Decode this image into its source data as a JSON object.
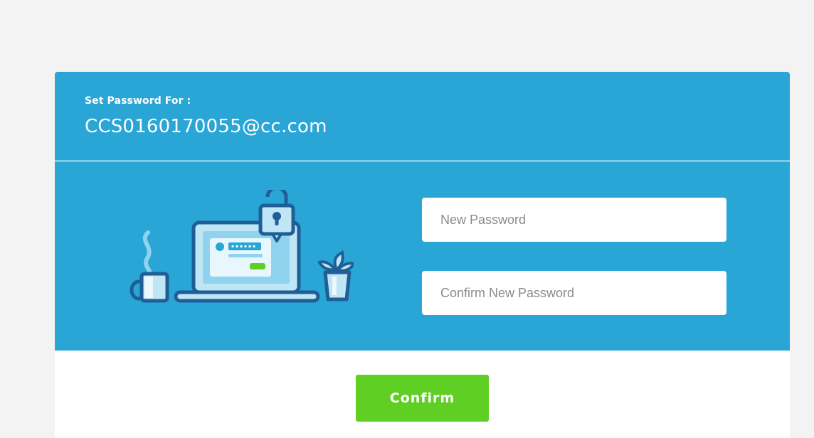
{
  "header": {
    "label": "Set Password For :",
    "email": "CCS0160170055@cc.com"
  },
  "form": {
    "new_password": {
      "value": "",
      "placeholder": "New Password"
    },
    "confirm_password": {
      "value": "",
      "placeholder": "Confirm New Password"
    },
    "confirm_label": "Confirm"
  },
  "illustration": {
    "icons": [
      "coffee-mug-icon",
      "laptop-icon",
      "padlock-icon",
      "plant-pot-icon"
    ]
  },
  "colors": {
    "page_background": "#f3f3f3",
    "panel_blue": "#29a6d6",
    "button_green": "#5fcf24",
    "illustration_dark": "#1f5f96",
    "illustration_light": "#bfe6f5"
  }
}
